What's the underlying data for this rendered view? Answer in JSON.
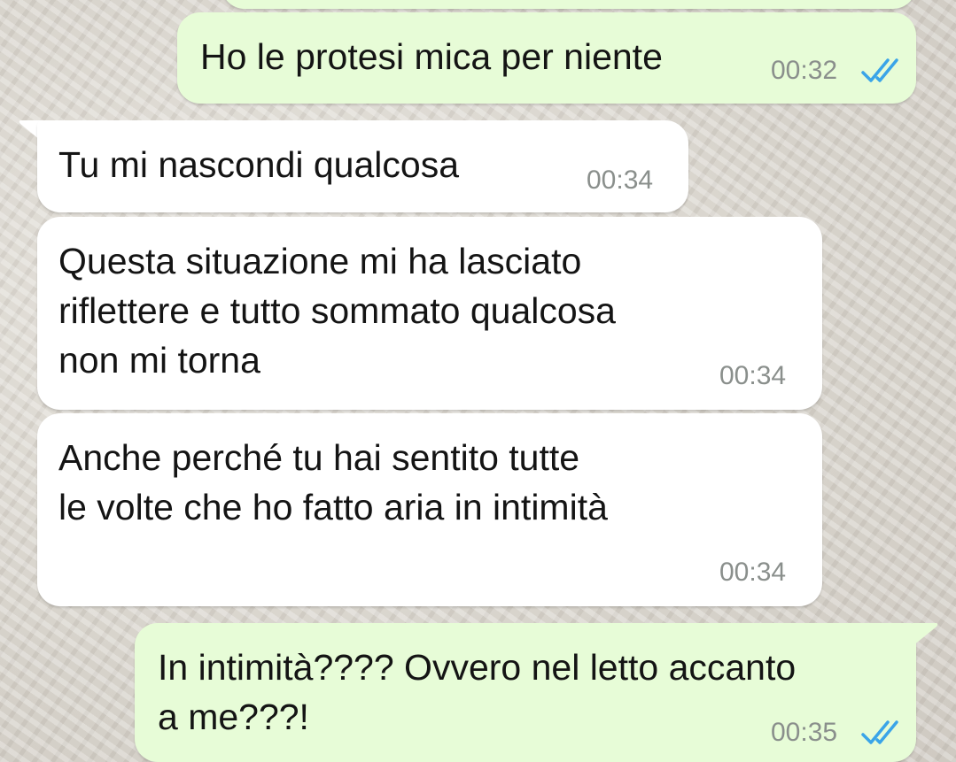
{
  "colors": {
    "outgoing_bubble": "#e7fcd7",
    "incoming_bubble": "#ffffff",
    "timestamp": "#8a8f8c",
    "read_ticks": "#3aa4e8"
  },
  "messages": [
    {
      "direction": "outgoing",
      "text": "Ho le protesi mica per niente",
      "time": "00:32",
      "status_icon": "double-check-read-icon"
    },
    {
      "direction": "incoming",
      "text": "Tu mi nascondi qualcosa",
      "time": "00:34"
    },
    {
      "direction": "incoming",
      "text": "Questa situazione mi ha lasciato\nriflettere e tutto sommato qualcosa\nnon mi torna",
      "time": "00:34"
    },
    {
      "direction": "incoming",
      "text": "Anche perché tu hai sentito tutte\nle volte che ho fatto aria in intimità",
      "time": "00:34"
    },
    {
      "direction": "outgoing",
      "text": "In intimità???? Ovvero nel letto accanto\na me???!",
      "time": "00:35",
      "status_icon": "double-check-read-icon"
    }
  ]
}
